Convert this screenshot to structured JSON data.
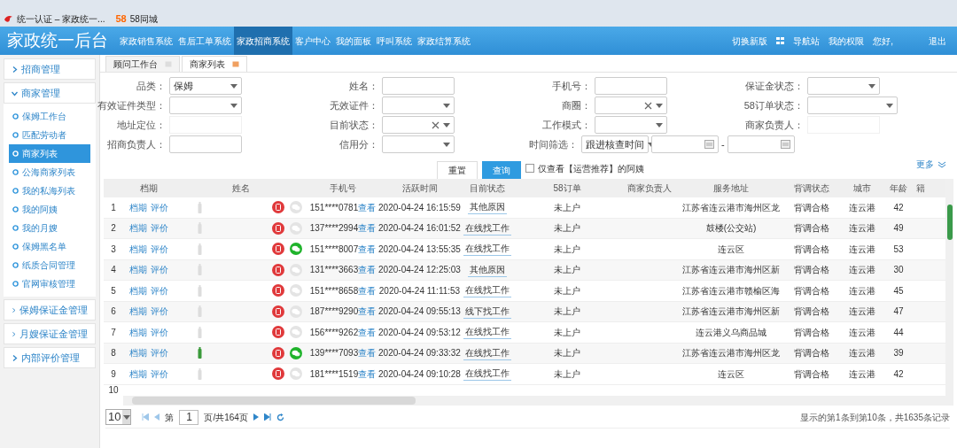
{
  "browser_tabs": [
    {
      "label": "统一认证 – 家政统一..."
    },
    {
      "label": "58同城",
      "logo": "58"
    }
  ],
  "header": {
    "title": "家政统一后台",
    "nav": [
      {
        "label": "家政销售系统",
        "selected": false
      },
      {
        "label": "售后工单系统",
        "selected": false
      },
      {
        "label": "家政招商系统",
        "selected": true
      },
      {
        "label": "客户中心",
        "selected": false
      },
      {
        "label": "我的面板",
        "selected": false
      },
      {
        "label": "呼叫系统",
        "selected": false
      },
      {
        "label": "家政结算系统",
        "selected": false
      }
    ],
    "right_links": [
      {
        "kind": "link",
        "label": "切换新版"
      },
      {
        "kind": "grid"
      },
      {
        "kind": "link",
        "label": "导航站"
      },
      {
        "kind": "link",
        "label": "我的权限"
      },
      {
        "kind": "link",
        "label": "您好,"
      },
      {
        "kind": "link",
        "label": "退出"
      }
    ]
  },
  "sidebar": [
    {
      "label": "招商管理",
      "expanded": false
    },
    {
      "label": "商家管理",
      "expanded": true,
      "children": [
        {
          "label": "保姆工作台",
          "selected": false
        },
        {
          "label": "匹配劳动者",
          "selected": false
        },
        {
          "label": "商家列表",
          "selected": true
        },
        {
          "label": "公海商家列表",
          "selected": false
        },
        {
          "label": "我的私海列表",
          "selected": false
        },
        {
          "label": "我的阿姨",
          "selected": false
        },
        {
          "label": "我的月嫂",
          "selected": false
        },
        {
          "label": "保姆黑名单",
          "selected": false
        },
        {
          "label": "纸质合同管理",
          "selected": false
        },
        {
          "label": "官网审核管理",
          "selected": false
        }
      ]
    },
    {
      "label": "保姆保证金管理",
      "expanded": false
    },
    {
      "label": "月嫂保证金管理",
      "expanded": false
    },
    {
      "label": "内部评价管理",
      "expanded": false
    }
  ],
  "page_tabs": [
    {
      "label": "顾问工作台",
      "selected": false
    },
    {
      "label": "商家列表",
      "selected": true
    }
  ],
  "filters": [
    {
      "label": "品类：",
      "kind": "select",
      "value": "保姆"
    },
    {
      "label": "姓名：",
      "kind": "input"
    },
    {
      "label": "手机号：",
      "kind": "input"
    },
    {
      "label": "保证金状态：",
      "kind": "select"
    },
    {
      "label": "有效证件类型：",
      "kind": "select"
    },
    {
      "label": "无效证件：",
      "kind": "select"
    },
    {
      "label": "商圈：",
      "kind": "select",
      "clear": true
    },
    {
      "label": "58订单状态：",
      "kind": "wideselect"
    },
    {
      "label": "地址定位：",
      "kind": "faint"
    },
    {
      "label": "目前状态：",
      "kind": "select",
      "clear": true
    },
    {
      "label": "工作模式：",
      "kind": "select"
    },
    {
      "label": "商家负责人：",
      "kind": "faint"
    },
    {
      "label": "招商负责人：",
      "kind": "input"
    },
    {
      "label": "信用分：",
      "kind": "select"
    },
    {
      "label": "时间筛选：",
      "kind": "daterange",
      "value": "跟进核查时间",
      "separator": "-"
    }
  ],
  "actions": {
    "reset": "重置",
    "search": "查询",
    "checkbox": {
      "label": "仅查看【运营推荐】的阿姨",
      "checked": false
    },
    "more": "更多"
  },
  "table": {
    "columns": [
      "档期",
      "姓名",
      "手机号",
      "活跃时间",
      "目前状态",
      "58订单",
      "商家负责人",
      "服务地址",
      "背调状态",
      "城市",
      "年龄",
      "籍"
    ],
    "rows": [
      {
        "index": "1",
        "links": [
          "档期",
          "评价"
        ],
        "certified": false,
        "wechat": false,
        "phone": "151****0781",
        "view": "查看",
        "time": "2020-04-24 16:15:59",
        "status": "其他原因",
        "order": "未上户",
        "address": "江苏省连云港市海州区龙",
        "check": "背调合格",
        "city": "连云港",
        "age": "42"
      },
      {
        "index": "2",
        "links": [
          "档期",
          "评价"
        ],
        "certified": false,
        "wechat": false,
        "phone": "137****2994",
        "view": "查看",
        "time": "2020-04-24 16:01:52",
        "status": "在线找工作",
        "order": "未上户",
        "address": "鼓楼(公交站)",
        "check": "背调合格",
        "city": "连云港",
        "age": "49"
      },
      {
        "index": "3",
        "links": [
          "档期",
          "评价"
        ],
        "certified": false,
        "wechat": true,
        "phone": "151****8007",
        "view": "查看",
        "time": "2020-04-24 13:55:35",
        "status": "在线找工作",
        "order": "未上户",
        "address": "连云区",
        "check": "背调合格",
        "city": "连云港",
        "age": "53"
      },
      {
        "index": "4",
        "links": [
          "档期",
          "评价"
        ],
        "certified": false,
        "wechat": false,
        "phone": "131****3663",
        "view": "查看",
        "time": "2020-04-24 12:25:03",
        "status": "其他原因",
        "order": "未上户",
        "address": "江苏省连云港市海州区新",
        "check": "背调合格",
        "city": "连云港",
        "age": "30"
      },
      {
        "index": "5",
        "links": [
          "档期",
          "评价"
        ],
        "certified": false,
        "wechat": false,
        "phone": "151****8658",
        "view": "查看",
        "time": "2020-04-24 11:11:53",
        "status": "在线找工作",
        "order": "未上户",
        "address": "江苏省连云港市赣榆区海",
        "check": "背调合格",
        "city": "连云港",
        "age": "45"
      },
      {
        "index": "6",
        "links": [
          "档期",
          "评价"
        ],
        "certified": false,
        "wechat": false,
        "phone": "187****9290",
        "view": "查看",
        "time": "2020-04-24 09:55:13",
        "status": "线下找工作",
        "order": "未上户",
        "address": "江苏省连云港市海州区新",
        "check": "背调合格",
        "city": "连云港",
        "age": "47"
      },
      {
        "index": "7",
        "links": [
          "档期",
          "评价"
        ],
        "certified": false,
        "wechat": false,
        "phone": "156****9262",
        "view": "查看",
        "time": "2020-04-24 09:53:12",
        "status": "在线找工作",
        "order": "未上户",
        "address": "连云港义乌商品城",
        "check": "背调合格",
        "city": "连云港",
        "age": "44"
      },
      {
        "index": "8",
        "links": [
          "档期",
          "评价"
        ],
        "certified": true,
        "wechat": true,
        "phone": "139****7093",
        "view": "查看",
        "time": "2020-04-24 09:33:32",
        "status": "在线找工作",
        "order": "未上户",
        "address": "江苏省连云港市海州区龙",
        "check": "背调合格",
        "city": "连云港",
        "age": "39"
      },
      {
        "index": "9",
        "links": [
          "档期",
          "评价"
        ],
        "certified": false,
        "wechat": false,
        "phone": "181****1519",
        "view": "查看",
        "time": "2020-04-24 09:10:28",
        "status": "在线找工作",
        "order": "未上户",
        "address": "连云区",
        "check": "背调合格",
        "city": "连云港",
        "age": "42"
      }
    ],
    "partial_row": {
      "index": "10"
    }
  },
  "pagination": {
    "page_size": "10",
    "page_prefix": "第",
    "page": "1",
    "page_suffix": "页/共164页",
    "summary": "显示的第1条到第10条，共1635条记录"
  }
}
